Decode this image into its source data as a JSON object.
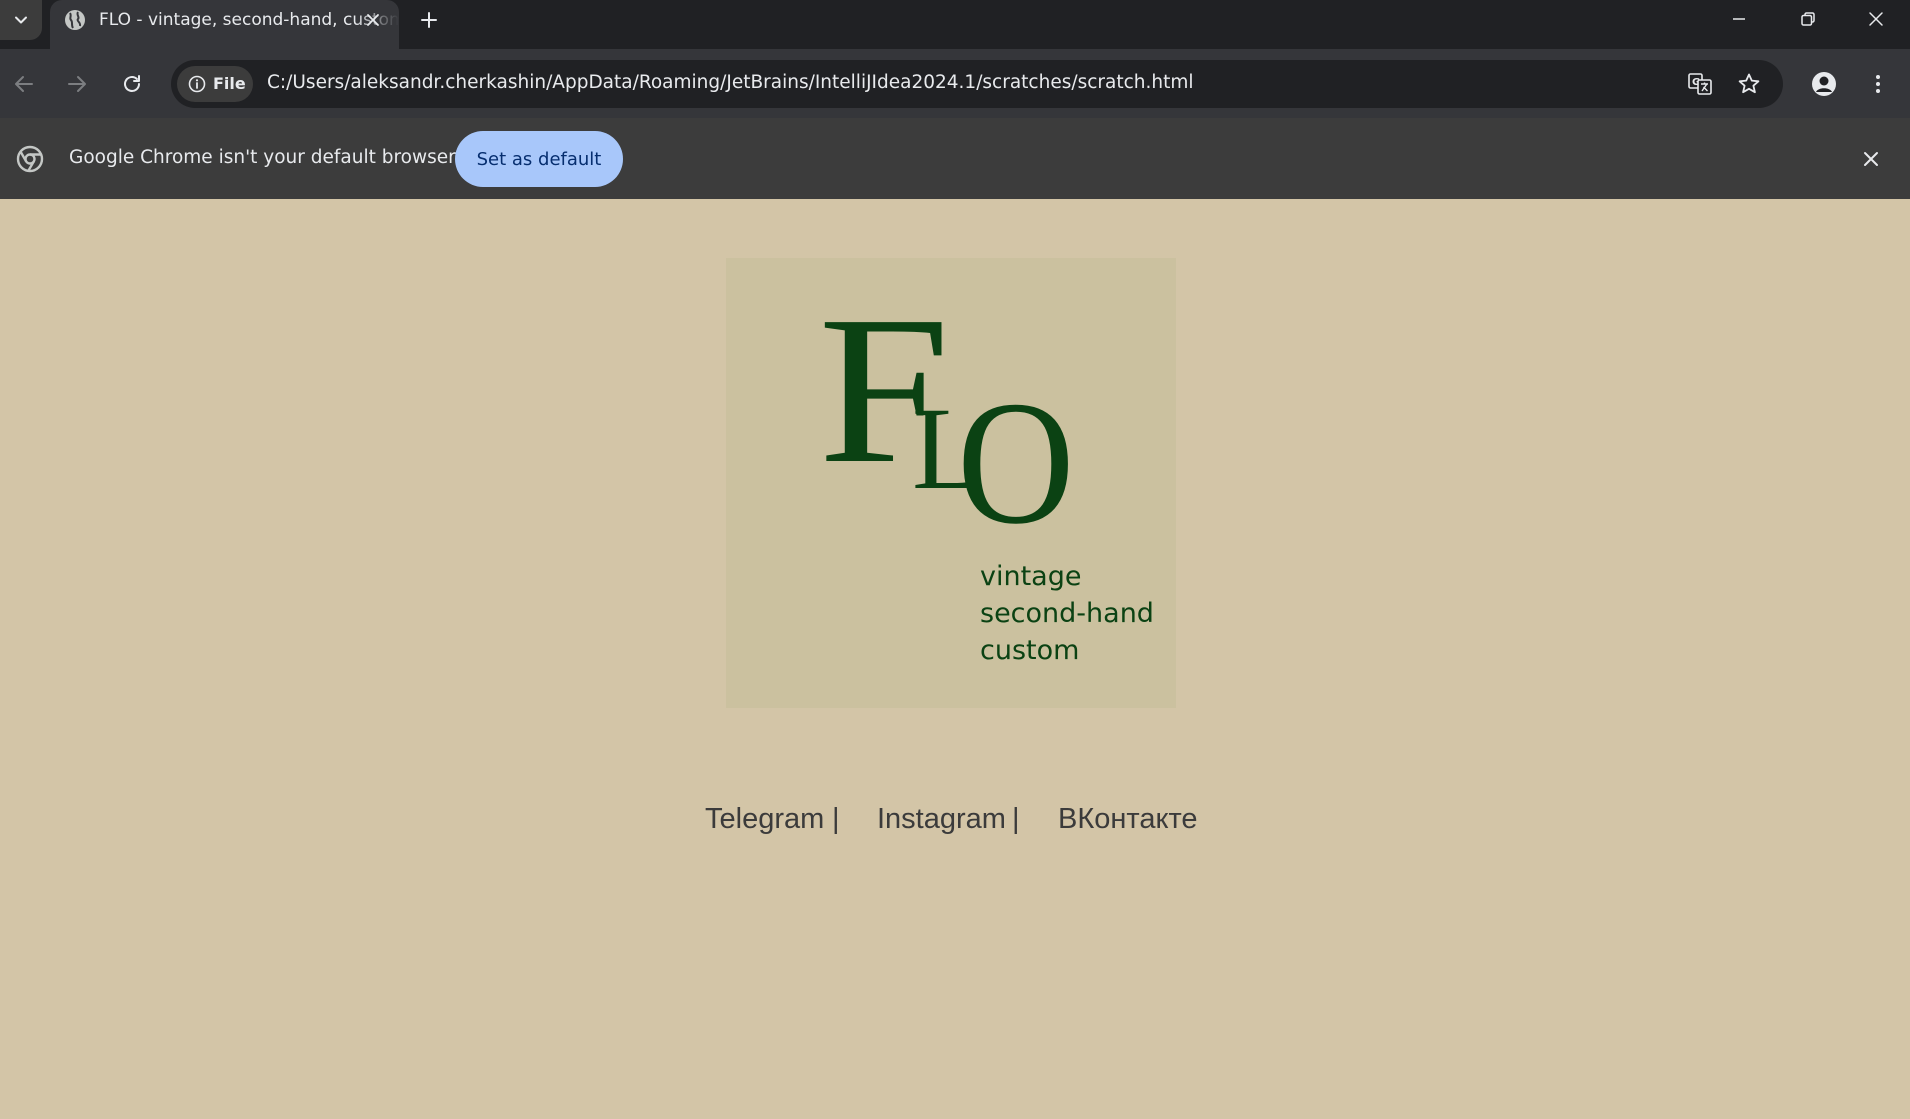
{
  "browser": {
    "tab": {
      "title": "FLO - vintage, second-hand, custom",
      "favicon": "globe-icon"
    },
    "toolbar": {
      "site_chip_label": "File",
      "url": "C:/Users/aleksandr.cherkashin/AppData/Roaming/JetBrains/IntelliJIdea2024.1/scratches/scratch.html"
    },
    "infobar": {
      "message": "Google Chrome isn't your default browser",
      "button_label": "Set as default"
    },
    "colors": {
      "frame": "#202124",
      "toolbar": "#35363a",
      "infobar": "#3c3c3c",
      "accent_button": "#a8c7fa"
    }
  },
  "page": {
    "logo": {
      "letter_f": "F",
      "letter_l": "L",
      "letter_o": "O",
      "tagline": [
        "vintage",
        "second-hand",
        "custom"
      ]
    },
    "links": [
      {
        "label": "Telegram",
        "separator": "|"
      },
      {
        "label": "Instagram",
        "separator": "|"
      },
      {
        "label": "ВКонтакте"
      }
    ],
    "colors": {
      "background": "#d3c5a7",
      "logo_box": "#cbc19f",
      "logo_green": "#0b4213",
      "link_text": "#3b3b3b"
    }
  }
}
